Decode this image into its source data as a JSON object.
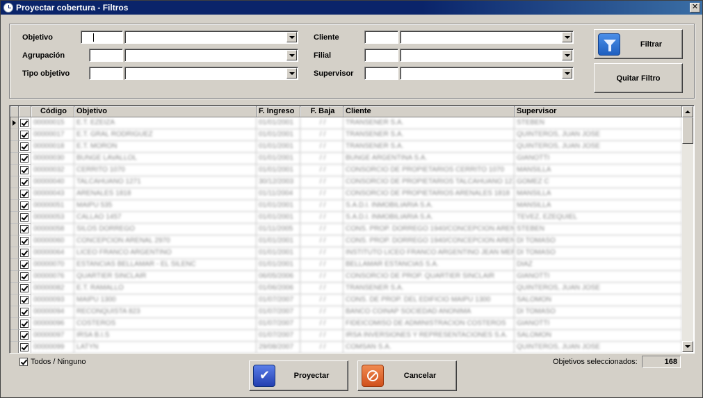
{
  "window": {
    "title": "Proyectar cobertura - Filtros"
  },
  "filters": {
    "objetivo_label": "Objetivo",
    "agrupacion_label": "Agrupación",
    "tipo_objetivo_label": "Tipo objetivo",
    "cliente_label": "Cliente",
    "filial_label": "Filial",
    "supervisor_label": "Supervisor"
  },
  "buttons": {
    "filtrar": "Filtrar",
    "quitar_filtro": "Quitar Filtro",
    "proyectar": "Proyectar",
    "cancelar": "Cancelar"
  },
  "grid": {
    "columns": [
      "Código",
      "Objetivo",
      "F. Ingreso",
      "F. Baja",
      "Cliente",
      "Supervisor"
    ],
    "rows": [
      {
        "codigo": "00000015",
        "objetivo": "E.T. EZEIZA",
        "ingreso": "01/01/2001",
        "baja": "/ /",
        "cliente": "TRANSENER S.A.",
        "supervisor": "STEBEN"
      },
      {
        "codigo": "00000017",
        "objetivo": "E.T. GRAL RODRIGUEZ",
        "ingreso": "01/01/2001",
        "baja": "/ /",
        "cliente": "TRANSENER S.A.",
        "supervisor": "QUINTEROS, JUAN JOSE"
      },
      {
        "codigo": "00000018",
        "objetivo": "E.T. MORON",
        "ingreso": "01/01/2001",
        "baja": "/ /",
        "cliente": "TRANSENER S.A.",
        "supervisor": "QUINTEROS, JUAN JOSE"
      },
      {
        "codigo": "00000030",
        "objetivo": "BUNGE LAVALLOL",
        "ingreso": "01/01/2001",
        "baja": "/ /",
        "cliente": "BUNGE ARGENTINA S.A.",
        "supervisor": "GIANOTTI"
      },
      {
        "codigo": "00000032",
        "objetivo": "CERRITO 1070",
        "ingreso": "01/01/2001",
        "baja": "/ /",
        "cliente": "CONSORCIO DE PROPIETARIOS CERRITO 1070",
        "supervisor": "MANSILLA"
      },
      {
        "codigo": "00000040",
        "objetivo": "TALCAHUANO 1271",
        "ingreso": "30/12/2003",
        "baja": "/ /",
        "cliente": "CONSORCIO DE PROPIETARIOS TALCAHUANO 1271",
        "supervisor": "GOMEZ C"
      },
      {
        "codigo": "00000043",
        "objetivo": "ARENALES 1818",
        "ingreso": "01/11/2004",
        "baja": "/ /",
        "cliente": "CONSORCIO DE PROPIETARIOS ARENALES 1818",
        "supervisor": "MANSILLA"
      },
      {
        "codigo": "00000051",
        "objetivo": "MAIPU 535",
        "ingreso": "01/01/2001",
        "baja": "/ /",
        "cliente": "S.A.D.I. INMOBILIARIA S.A.",
        "supervisor": "MANSILLA"
      },
      {
        "codigo": "00000053",
        "objetivo": "CALLAO 1457",
        "ingreso": "01/01/2001",
        "baja": "/ /",
        "cliente": "S.A.D.I. INMOBILIARIA S.A.",
        "supervisor": "TEVEZ, EZEQUIEL"
      },
      {
        "codigo": "00000058",
        "objetivo": "SILOS DORREGO",
        "ingreso": "01/11/2005",
        "baja": "/ /",
        "cliente": "CONS. PROP. DORREGO 1940/CONCEPCION AREN",
        "supervisor": "STEBEN"
      },
      {
        "codigo": "00000060",
        "objetivo": "CONCEPCION ARENAL 2970",
        "ingreso": "01/01/2001",
        "baja": "/ /",
        "cliente": "CONS. PROP. DORREGO 1940/CONCEPCION AREN",
        "supervisor": "DI TOMASO"
      },
      {
        "codigo": "00000064",
        "objetivo": "LICEO FRANCO ARGENTINO",
        "ingreso": "01/01/2001",
        "baja": "/ /",
        "cliente": "INSTITUTO LICEO FRANCO ARGENTINO JEAN MER",
        "supervisor": "DI TOMASO"
      },
      {
        "codigo": "00000070",
        "objetivo": "ESTANCIAS BELLAMAR - EL SILENC",
        "ingreso": "01/01/2001",
        "baja": "/ /",
        "cliente": "BELLAMAR ESTANCIAS S.A.",
        "supervisor": "DIAZ"
      },
      {
        "codigo": "00000076",
        "objetivo": "QUARTIER SINCLAIR",
        "ingreso": "06/05/2006",
        "baja": "/ /",
        "cliente": "CONSORCIO DE PROP. QUARTIER SINCLAIR",
        "supervisor": "GIANOTTI"
      },
      {
        "codigo": "00000082",
        "objetivo": "E.T. RAMALLO",
        "ingreso": "01/06/2006",
        "baja": "/ /",
        "cliente": "TRANSENER S.A.",
        "supervisor": "QUINTEROS, JUAN JOSE"
      },
      {
        "codigo": "00000093",
        "objetivo": "MAIPU 1300",
        "ingreso": "01/07/2007",
        "baja": "/ /",
        "cliente": "CONS. DE PROP. DEL EDIFICIO MAIPU 1300",
        "supervisor": "SALOMON"
      },
      {
        "codigo": "00000094",
        "objetivo": "RECONQUISTA 823",
        "ingreso": "01/07/2007",
        "baja": "/ /",
        "cliente": "BANCO COINAP SOCIEDAD ANONIMA",
        "supervisor": "DI TOMASO"
      },
      {
        "codigo": "00000096",
        "objetivo": "COSTEROS",
        "ingreso": "01/07/2007",
        "baja": "/ /",
        "cliente": "FIDEICOMISO DE ADMINISTRACION COSTEROS",
        "supervisor": "GIANOTTI"
      },
      {
        "codigo": "00000097",
        "objetivo": "IRSA B.I.S",
        "ingreso": "01/07/2007",
        "baja": "/ /",
        "cliente": "IRSA INVERSIONES Y REPRESENTACIONES S.A.",
        "supervisor": "SALOMON"
      },
      {
        "codigo": "00000099",
        "objetivo": "LATYN",
        "ingreso": "29/08/2007",
        "baja": "/ /",
        "cliente": "COMSAN S.A.",
        "supervisor": "QUINTEROS, JUAN JOSE"
      }
    ]
  },
  "footer": {
    "todos_label": "Todos / Ninguno",
    "selected_label": "Objetivos seleccionados:",
    "selected_count": "168"
  }
}
